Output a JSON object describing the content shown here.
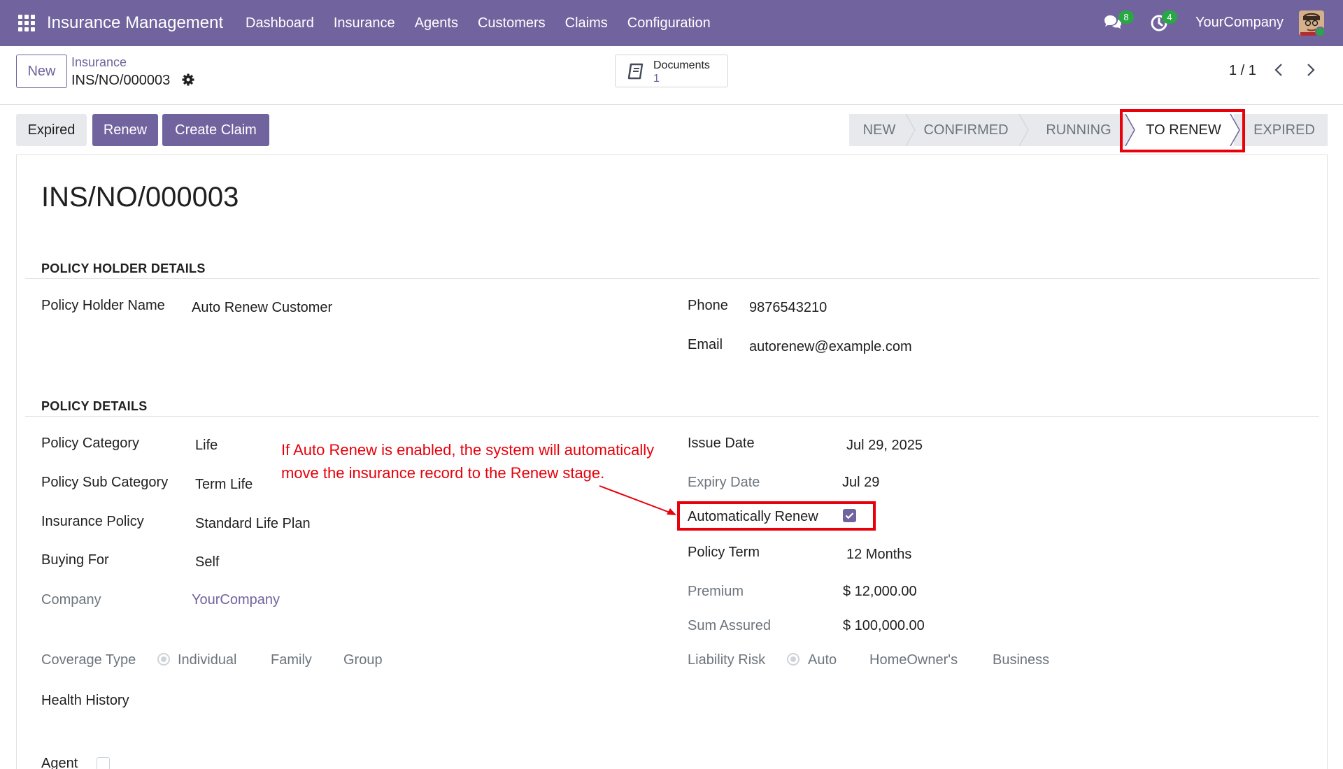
{
  "navbar": {
    "brand": "Insurance Management",
    "menu": [
      "Dashboard",
      "Insurance",
      "Agents",
      "Customers",
      "Claims",
      "Configuration"
    ],
    "chat_count": "8",
    "activity_count": "4",
    "company": "YourCompany"
  },
  "control": {
    "new_label": "New",
    "breadcrumb_parent": "Insurance",
    "breadcrumb_current": "INS/NO/000003",
    "documents_label": "Documents",
    "documents_count": "1",
    "pager": "1 / 1"
  },
  "actions": {
    "expired": "Expired",
    "renew": "Renew",
    "create_claim": "Create Claim"
  },
  "stages": {
    "items": [
      "NEW",
      "CONFIRMED",
      "RUNNING",
      "TO RENEW",
      "EXPIRED"
    ],
    "active": "TO RENEW"
  },
  "record": {
    "title": "INS/NO/000003",
    "holder_section": "POLICY HOLDER DETAILS",
    "holder_name_label": "Policy Holder Name",
    "holder_name": "Auto Renew Customer",
    "phone_label": "Phone",
    "phone": "9876543210",
    "email_label": "Email",
    "email": "autorenew@example.com",
    "policy_section": "POLICY DETAILS",
    "category_label": "Policy Category",
    "category": "Life",
    "sub_category_label": "Policy Sub Category",
    "sub_category": "Term Life",
    "insurance_policy_label": "Insurance Policy",
    "insurance_policy": "Standard Life Plan",
    "buying_for_label": "Buying For",
    "buying_for": "Self",
    "company_label": "Company",
    "company": "YourCompany",
    "coverage_label": "Coverage Type",
    "coverage_options": [
      "Individual",
      "Family",
      "Group"
    ],
    "health_history_label": "Health History",
    "agent_label": "Agent",
    "issue_date_label": "Issue Date",
    "issue_date": "Jul 29, 2025",
    "expiry_date_label": "Expiry Date",
    "expiry_date": "Jul 29",
    "auto_renew_label": "Automatically Renew",
    "auto_renew": true,
    "policy_term_label": "Policy Term",
    "policy_term": "12 Months",
    "premium_label": "Premium",
    "premium": "$ 12,000.00",
    "sum_assured_label": "Sum Assured",
    "sum_assured": "$ 100,000.00",
    "liability_label": "Liability Risk",
    "liability_options": [
      "Auto",
      "HomeOwner's",
      "Business"
    ]
  },
  "annotation": {
    "line1": "If Auto Renew is enabled, the system will automatically",
    "line2": "move the insurance record to the Renew stage."
  },
  "colors": {
    "brand": "#71639e",
    "highlight": "#e8000b",
    "badge": "#28a745"
  }
}
